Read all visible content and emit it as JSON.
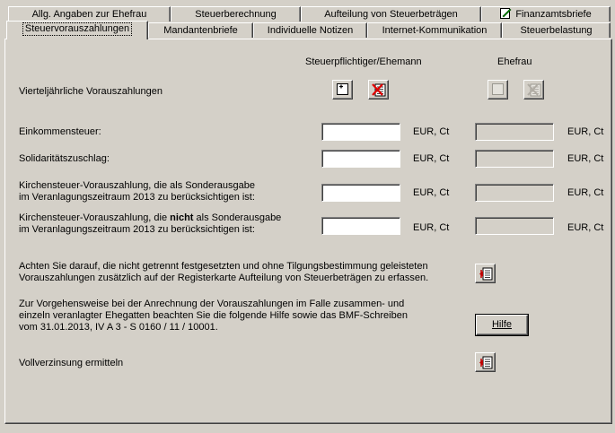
{
  "tabs_row1": [
    {
      "label": "Allg. Angaben zur Ehefrau"
    },
    {
      "label": "Steuerberechnung"
    },
    {
      "label": "Aufteilung von Steuerbeträgen"
    },
    {
      "label": "Finanzamtsbriefe"
    }
  ],
  "tabs_row2": [
    {
      "label": "Steuervorauszahlungen"
    },
    {
      "label": "Mandantenbriefe"
    },
    {
      "label": "Individuelle Notizen"
    },
    {
      "label": "Internet-Kommunikation"
    },
    {
      "label": "Steuerbelastung"
    }
  ],
  "columns": {
    "taxpayer": "Steuerpflichtiger/Ehemann",
    "spouse": "Ehefrau"
  },
  "quarterly_label": "Vierteljährliche Vorauszahlungen",
  "rows": [
    {
      "label": "Einkommensteuer:",
      "value_taxpayer": "",
      "value_spouse": "",
      "unit": "EUR, Ct"
    },
    {
      "label": "Solidaritätszuschlag:",
      "value_taxpayer": "",
      "value_spouse": "",
      "unit": "EUR, Ct"
    },
    {
      "label_line1": "Kirchensteuer-Vorauszahlung, die als Sonderausgabe",
      "label_line2": "im Veranlagungszeitraum 2013 zu berücksichtigen ist:",
      "value_taxpayer": "",
      "value_spouse": "",
      "unit": "EUR, Ct"
    },
    {
      "label_line1a": "Kirchensteuer-Vorauszahlung, die ",
      "label_line1b": "nicht",
      "label_line1c": " als Sonderausgabe",
      "label_line2": "im Veranlagungszeitraum 2013 zu berücksichtigen ist:",
      "value_taxpayer": "",
      "value_spouse": "",
      "unit": "EUR, Ct"
    }
  ],
  "notice1_line1": "Achten Sie darauf, die nicht getrennt festgesetzten und ohne Tilgungsbestimmung geleisteten",
  "notice1_line2": "Vorauszahlungen zusätzlich auf der Registerkarte Aufteilung von Steuerbeträgen zu erfassen.",
  "notice2_line1": "Zur Vorgehensweise bei der Anrechnung der Vorauszahlungen im Falle zusammen- und",
  "notice2_line2": "einzeln veranlagter Ehegatten beachten Sie die folgende Hilfe sowie das BMF-Schreiben",
  "notice2_line3": "vom 31.01.2013, IV A 3 - S 0160 / 11 / 10001.",
  "help_button": "Hilfe",
  "interest_label": "Vollverzinsung ermitteln",
  "icons": {
    "add": "add-record-icon",
    "delete": "delete-record-icon",
    "navigate": "navigate-table-icon",
    "finanzamt": "edit-note-icon"
  }
}
